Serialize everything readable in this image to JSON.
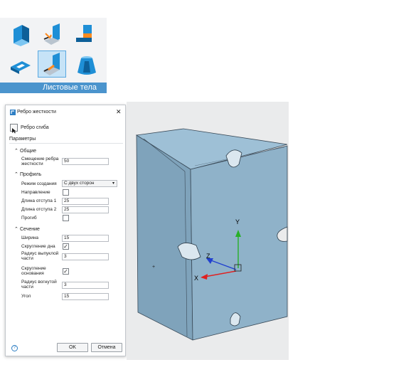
{
  "ribbon": {
    "group_label": "Листовые тела",
    "tools": [
      {
        "icon": "sheet-body-icon",
        "selected": false
      },
      {
        "icon": "bend-icon",
        "selected": false
      },
      {
        "icon": "joggle-icon",
        "selected": false
      },
      {
        "icon": "flange-icon",
        "selected": false
      },
      {
        "icon": "stiffening-rib-icon",
        "selected": true
      },
      {
        "icon": "lofted-flange-icon",
        "selected": false
      }
    ]
  },
  "dialog": {
    "title": "Ребро жесткости",
    "target_label": "Ребро сгиба",
    "params_label": "Параметры",
    "sections": {
      "general": {
        "title": "Общие",
        "offset_label": "Смещение ребра жесткости",
        "offset_value": "50"
      },
      "profile": {
        "title": "Профиль",
        "mode_label": "Режим создания",
        "mode_value": "С двух сторон",
        "direction_label": "Направление",
        "offset1_label": "Длина отступа 1",
        "offset1_value": "25",
        "offset2_label": "Длина отступа 2",
        "offset2_value": "25",
        "deflection_label": "Прогиб"
      },
      "section": {
        "title": "Сечение",
        "width_label": "Ширина",
        "width_value": "15",
        "round_bottom_label": "Скругление дна",
        "convex_radius_label": "Радиус выпуклой части",
        "convex_radius_value": "3",
        "round_base_label": "Скругление основания",
        "concave_radius_label": "Радиус вогнутой части",
        "concave_radius_value": "3",
        "angle_label": "Угол",
        "angle_value": "15"
      }
    },
    "checkboxes": {
      "direction": false,
      "deflection": false,
      "round_bottom": true,
      "round_base": true
    },
    "ok_label": "OK",
    "cancel_label": "Отмена",
    "help_label": "?",
    "close_label": "✕"
  },
  "viewport": {
    "axis_y": "Y",
    "axis_z": "Z",
    "axis_x": "X",
    "colors": {
      "part_face": "#8fb2c9",
      "part_top": "#9ec0d6",
      "part_side": "#7fa3bb",
      "x_axis": "#e02020",
      "y_axis": "#28b028",
      "z_axis": "#2040d0"
    }
  },
  "colors": {
    "ribbon_label_bg": "#4b94cd",
    "ribbon_selected_bg": "#c6e3f7"
  }
}
